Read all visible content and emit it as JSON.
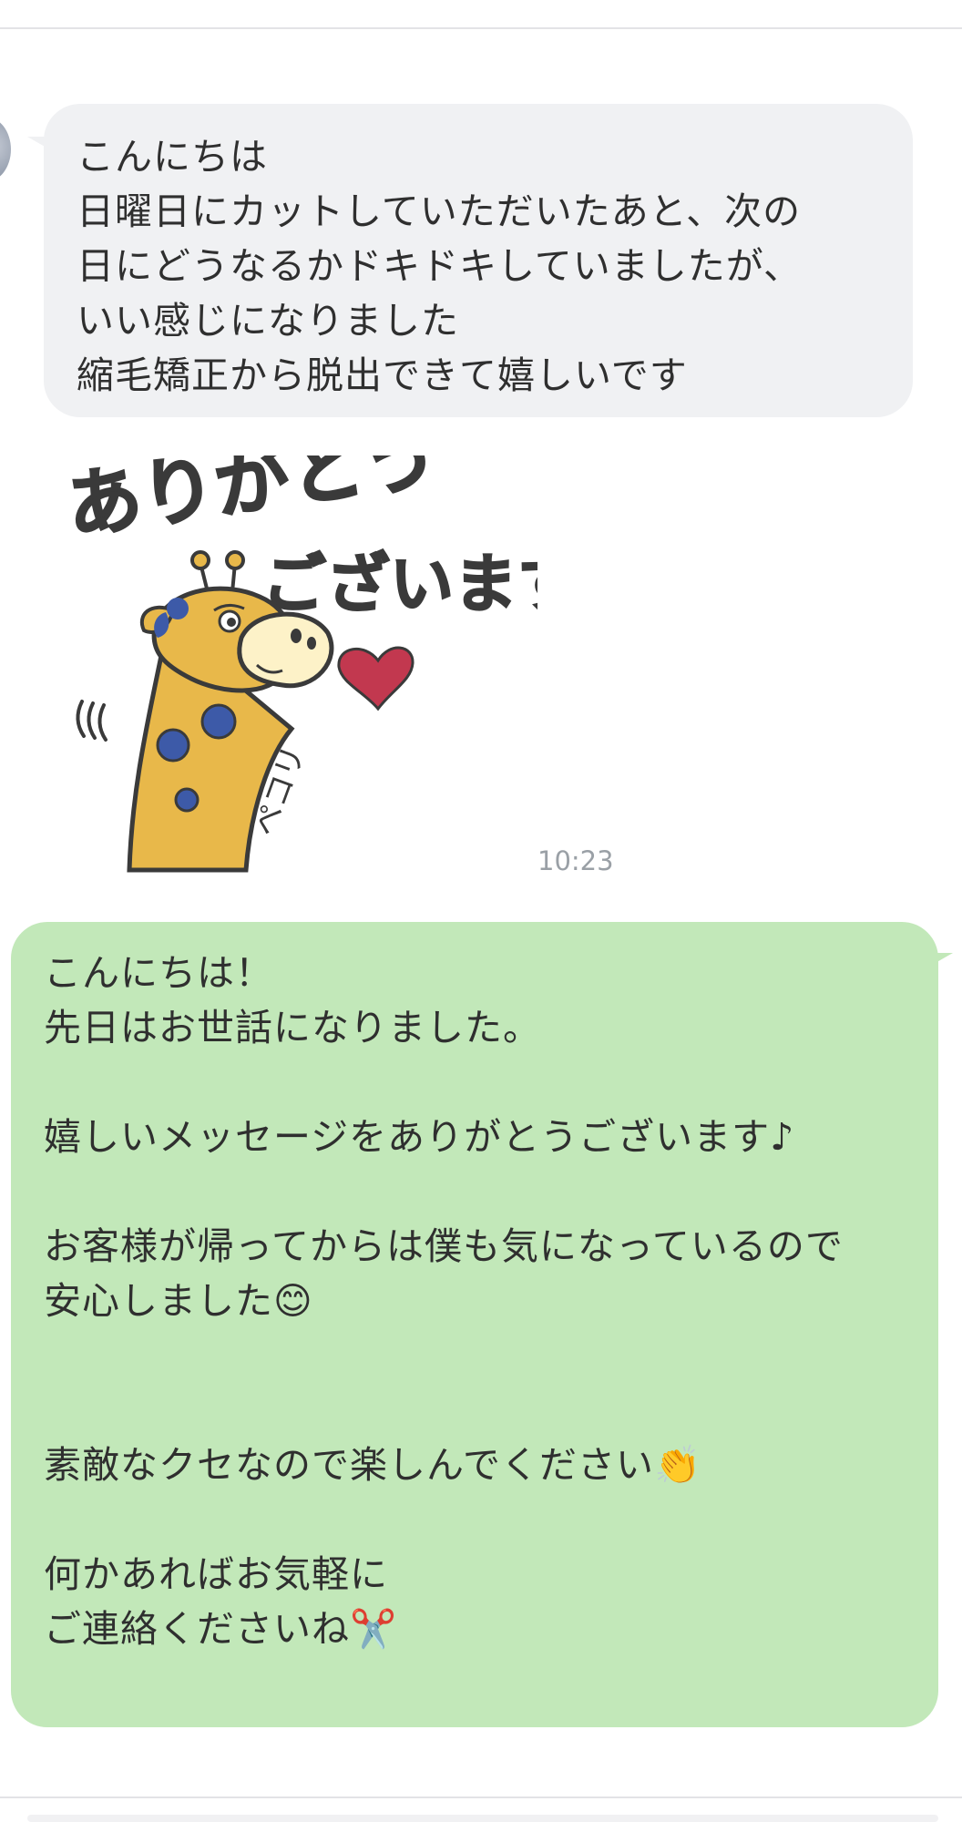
{
  "incoming_message": {
    "lines": [
      "こんにちは",
      "日曜日にカットしていただいたあと、次の",
      "日にどうなるかドキドキしていましたが、",
      "いい感じになりました",
      "縮毛矯正から脱出できて嬉しいです"
    ]
  },
  "sticker": {
    "text_line1": "ありがとう",
    "text_line2": "ございます",
    "sfx": "ペコリ",
    "time": "10:23"
  },
  "outgoing_message": {
    "lines": [
      "こんにちは！",
      "先日はお世話になりました。",
      "",
      "嬉しいメッセージをありがとうございます♪",
      "",
      "お客様が帰ってからは僕も気になっているので",
      "安心しました😊",
      "",
      "",
      "素敵なクセなので楽しんでください👏",
      "",
      "何かあればお気軽に",
      "ご連絡くださいね✂️"
    ]
  },
  "colors": {
    "incoming_bubble": "#f0f1f3",
    "outgoing_bubble": "#c2e8b9",
    "giraffe_body": "#e8b84a",
    "giraffe_spots": "#3d5aa8",
    "heart": "#c2384f"
  }
}
